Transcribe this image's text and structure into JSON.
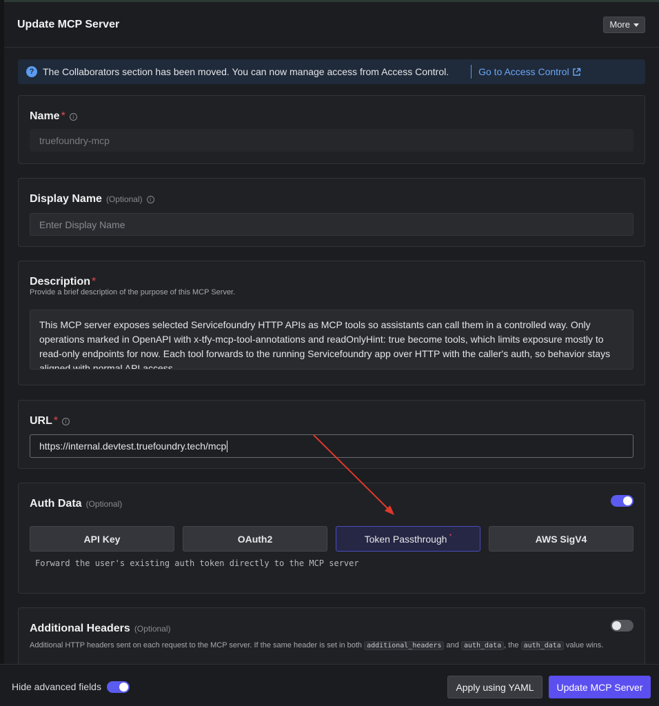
{
  "header": {
    "title": "Update MCP Server",
    "more_label": "More"
  },
  "banner": {
    "text": "The Collaborators section has been moved. You can now manage access from Access Control.",
    "link_label": "Go to Access Control"
  },
  "name_field": {
    "label": "Name",
    "required_mark": "*",
    "value": "truefoundry-mcp"
  },
  "display_name_field": {
    "label": "Display Name",
    "optional_label": "(Optional)",
    "placeholder": "Enter Display Name"
  },
  "description_field": {
    "label": "Description",
    "required_mark": "*",
    "help": "Provide a brief description of the purpose of this MCP Server.",
    "value": "This MCP server exposes selected Servicefoundry HTTP APIs as MCP tools so assistants can call them in a controlled way. Only operations marked in OpenAPI with x-tfy-mcp-tool-annotations and readOnlyHint: true become tools, which limits exposure mostly to read-only endpoints for now. Each tool forwards to the running Servicefoundry app over HTTP with the caller's auth, so behavior stays aligned with normal API access."
  },
  "url_field": {
    "label": "URL",
    "required_mark": "*",
    "value": "https://internal.devtest.truefoundry.tech/mcp"
  },
  "auth_data": {
    "label": "Auth Data",
    "optional_label": "(Optional)",
    "toggle_on": true,
    "options": [
      "API Key",
      "OAuth2",
      "Token Passthrough",
      "AWS SigV4"
    ],
    "selected": "Token Passthrough",
    "selected_mark": "*",
    "help": "Forward the user's existing auth token directly to the MCP server"
  },
  "additional_headers": {
    "label": "Additional Headers",
    "optional_label": "(Optional)",
    "toggle_on": false,
    "help_part1": "Additional HTTP headers sent on each request to the MCP server. If the same header is set in both",
    "code1": "additional_headers",
    "help_part2": "and",
    "code2": "auth_data",
    "help_part3": ", the",
    "code3": "auth_data",
    "help_part4": "value wins."
  },
  "footer": {
    "hide_advanced_label": "Hide advanced fields",
    "hide_advanced_on": true,
    "apply_yaml_label": "Apply using YAML",
    "update_label": "Update MCP Server"
  },
  "colors": {
    "accent": "#5b4ff0",
    "toggle_on": "#5b5bf0",
    "required": "#e5484d",
    "link": "#6aa7f6",
    "annotation_arrow": "#e0392b"
  }
}
